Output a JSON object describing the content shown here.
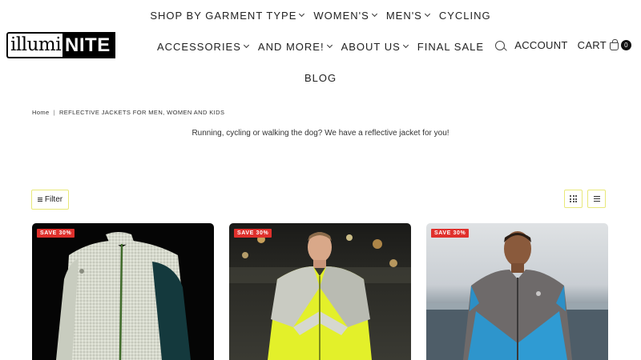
{
  "brand": {
    "logo_left": "illumi",
    "logo_right": "NITE"
  },
  "nav": {
    "row1": [
      {
        "label": "SHOP BY GARMENT TYPE",
        "has_dropdown": true
      },
      {
        "label": "WOMEN'S",
        "has_dropdown": true
      },
      {
        "label": "MEN'S",
        "has_dropdown": true
      },
      {
        "label": "CYCLING",
        "has_dropdown": false
      }
    ],
    "row2": [
      {
        "label": "ACCESSORIES",
        "has_dropdown": true
      },
      {
        "label": "AND MORE!",
        "has_dropdown": true
      },
      {
        "label": "ABOUT US",
        "has_dropdown": true
      },
      {
        "label": "FINAL SALE",
        "has_dropdown": false
      }
    ],
    "row3": [
      {
        "label": "BLOG",
        "has_dropdown": false
      }
    ]
  },
  "header_tools": {
    "account_label": "ACCOUNT",
    "cart_label": "CART",
    "cart_count": "0",
    "search_icon": "search-icon",
    "cart_icon": "shopping-bag-icon"
  },
  "breadcrumb": {
    "home": "Home",
    "separator": "|",
    "current": "REFLECTIVE JACKETS FOR MEN, WOMEN AND KIDS"
  },
  "intro_text": "Running, cycling or walking the dog? We have a reflective jacket for you!",
  "toolbar": {
    "filter_label": "Filter",
    "grid_view_icon": "grid-view-icon",
    "list_view_icon": "list-view-icon"
  },
  "products": [
    {
      "badge": "SAVE 30%"
    },
    {
      "badge": "SAVE 30%"
    },
    {
      "badge": "SAVE 30%"
    }
  ],
  "colors": {
    "badge_red": "#e0302c",
    "toggle_border": "#e8e879",
    "cart_badge": "#111111"
  }
}
